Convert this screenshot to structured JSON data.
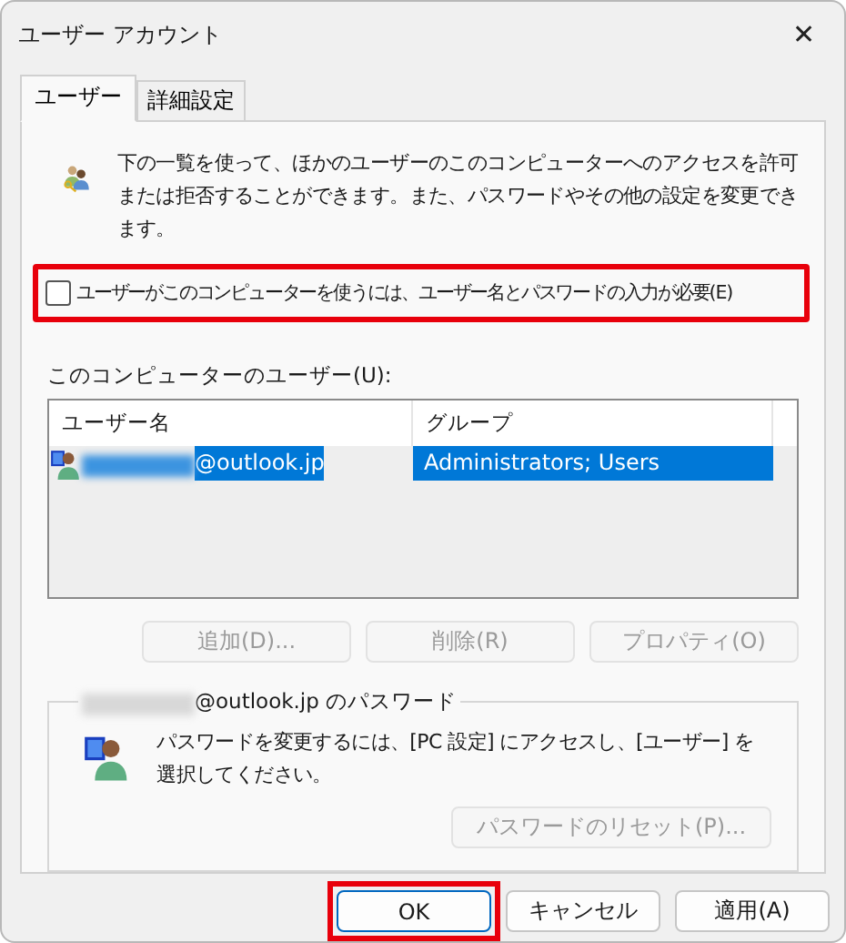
{
  "window": {
    "title": "ユーザー アカウント",
    "close": "✕"
  },
  "tabs": [
    {
      "label": "ユーザー",
      "selected": true
    },
    {
      "label": "詳細設定",
      "selected": false
    }
  ],
  "intro": "下の一覧を使って、ほかのユーザーのこのコンピューターへのアクセスを許可または拒否することができます。また、パスワードやその他の設定を変更できます。",
  "require_password": {
    "label": "ユーザーがこのコンピューターを使うには、ユーザー名とパスワードの入力が必要(E)",
    "checked": false,
    "highlighted": true
  },
  "users_label": "このコンピューターのユーザー(U):",
  "table": {
    "columns": [
      "ユーザー名",
      "グループ"
    ],
    "rows": [
      {
        "name": "@outlook.jp",
        "group": "Administrators; Users",
        "selected": true
      }
    ]
  },
  "user_buttons": [
    {
      "label": "追加(D)...",
      "disabled": true
    },
    {
      "label": "削除(R)",
      "disabled": true
    },
    {
      "label": "プロパティ(O)",
      "disabled": true
    }
  ],
  "password_group": {
    "title": "@outlook.jp のパスワード",
    "text": "パスワードを変更するには、[PC 設定] にアクセスし、[ユーザー] を選択してください。",
    "button": {
      "label": "パスワードのリセット(P)...",
      "disabled": true
    }
  },
  "footer_buttons": [
    {
      "label": "OK",
      "highlighted": true,
      "default": true
    },
    {
      "label": "キャンセル",
      "highlighted": false,
      "default": false
    },
    {
      "label": "適用(A)",
      "highlighted": false,
      "default": false
    }
  ]
}
